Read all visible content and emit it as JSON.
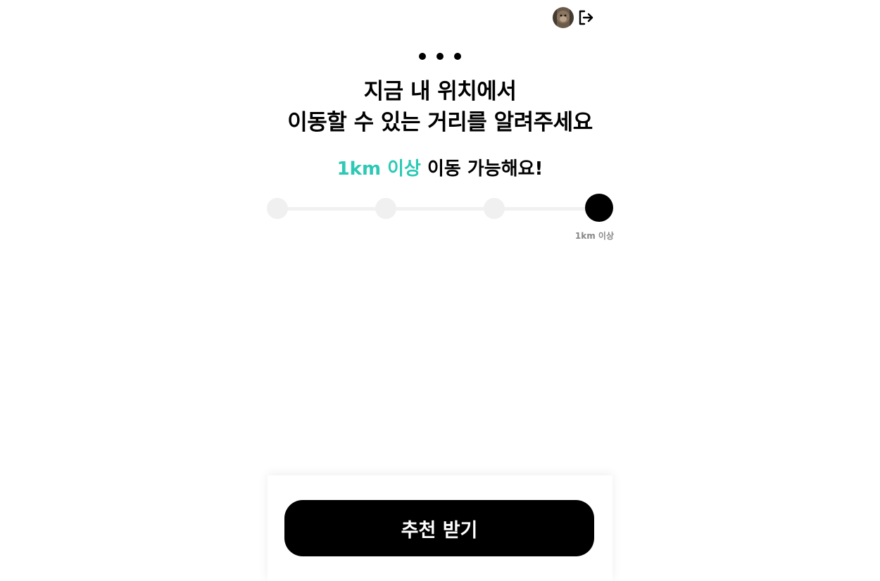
{
  "header": {
    "avatar_icon": "user-avatar",
    "logout_icon": "logout-icon"
  },
  "more_menu_icon": "ellipsis-icon",
  "title": {
    "line1": "지금 내 위치에서",
    "line2": "이동할 수 있는 거리를 알려주세요"
  },
  "summary": {
    "highlight": "1km 이상",
    "rest": " 이동 가능해요!"
  },
  "distance_slider": {
    "stops": 4,
    "selected_index": 3,
    "selected_label": "1km 이상"
  },
  "colors": {
    "accent": "#2cc9b5",
    "primary": "#000000",
    "track": "#f1f1f1",
    "caption": "#888888"
  },
  "cta": {
    "label": "추천 받기"
  }
}
